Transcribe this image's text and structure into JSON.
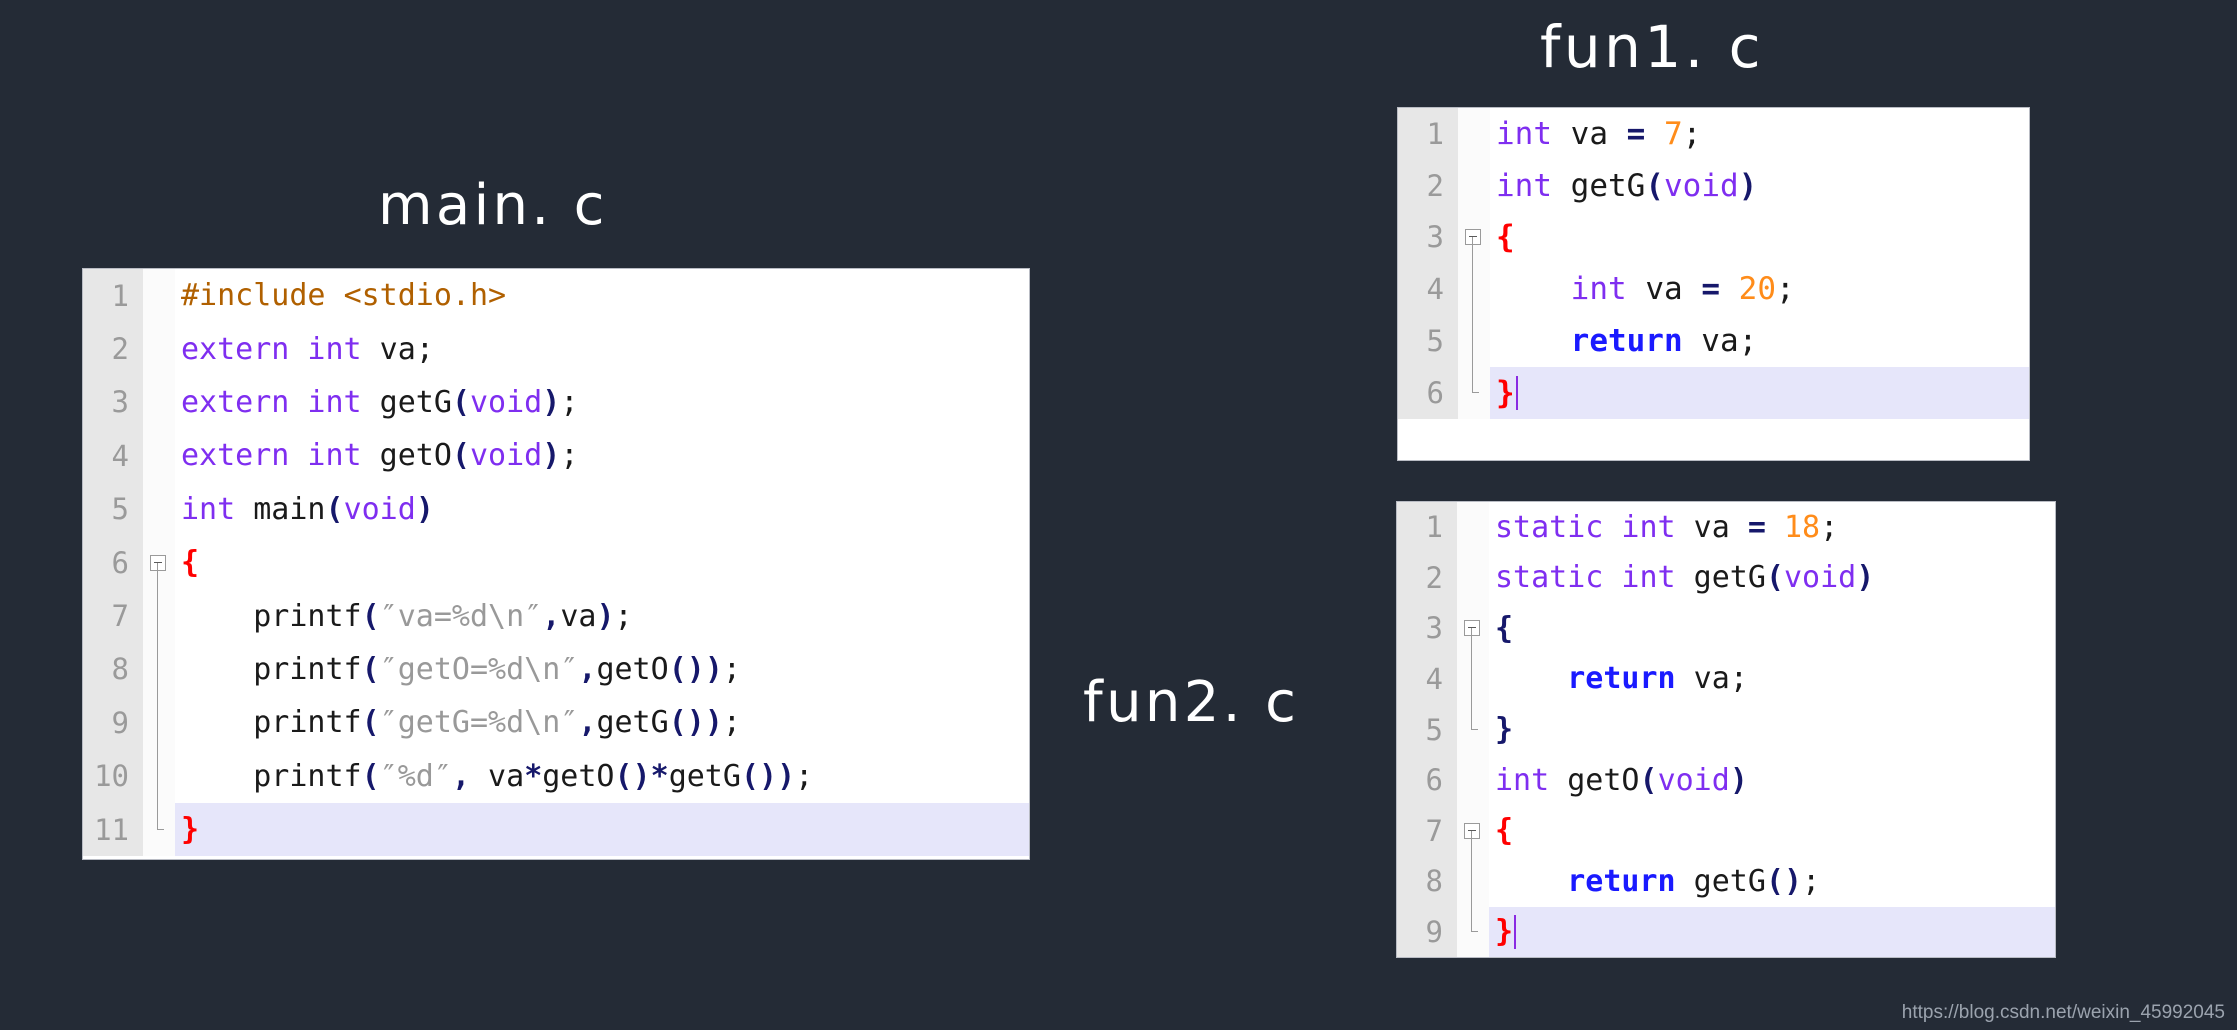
{
  "canvas": {
    "background": "#242b36",
    "watermark": "https://blog.csdn.net/weixin_45992045"
  },
  "labels": {
    "main": "main. c",
    "fun1": "fun1. c",
    "fun2": "fun2. c"
  },
  "colors": {
    "keyword": "#7f2ef0",
    "preprocessor": "#b06000",
    "number": "#ff8c1a",
    "string": "#999999",
    "return": "#1a1aff",
    "punctuation": "#16186b",
    "brace": "#ff0000",
    "plain": "#1a1a1a",
    "line_number": "#9a9a9a",
    "gutter_bg": "#e7e7e7",
    "current_line": "#e6e6fa",
    "editor_bg": "#ffffff",
    "caret": "#8a2be2"
  },
  "editors": {
    "main": {
      "filename": "main. c",
      "lines": [
        {
          "n": "1",
          "fold": "none",
          "current": false,
          "tokens": [
            {
              "t": "#include ",
              "c": "pp"
            },
            {
              "t": "<stdio.h>",
              "c": "inc"
            }
          ]
        },
        {
          "n": "2",
          "fold": "none",
          "current": false,
          "tokens": [
            {
              "t": "extern int",
              "c": "kw"
            },
            {
              "t": " va",
              "c": "plain"
            },
            {
              "t": ";",
              "c": "plain"
            }
          ]
        },
        {
          "n": "3",
          "fold": "none",
          "current": false,
          "tokens": [
            {
              "t": "extern int",
              "c": "kw"
            },
            {
              "t": " getG",
              "c": "plain"
            },
            {
              "t": "(",
              "c": "punc"
            },
            {
              "t": "void",
              "c": "kw"
            },
            {
              "t": ")",
              "c": "punc"
            },
            {
              "t": ";",
              "c": "plain"
            }
          ]
        },
        {
          "n": "4",
          "fold": "none",
          "current": false,
          "tokens": [
            {
              "t": "extern int",
              "c": "kw"
            },
            {
              "t": " getO",
              "c": "plain"
            },
            {
              "t": "(",
              "c": "punc"
            },
            {
              "t": "void",
              "c": "kw"
            },
            {
              "t": ")",
              "c": "punc"
            },
            {
              "t": ";",
              "c": "plain"
            }
          ]
        },
        {
          "n": "5",
          "fold": "none",
          "current": false,
          "tokens": [
            {
              "t": "int",
              "c": "kw"
            },
            {
              "t": " main",
              "c": "plain"
            },
            {
              "t": "(",
              "c": "punc"
            },
            {
              "t": "void",
              "c": "kw"
            },
            {
              "t": ")",
              "c": "punc"
            }
          ]
        },
        {
          "n": "6",
          "fold": "start",
          "current": false,
          "tokens": [
            {
              "t": "{",
              "c": "brace"
            }
          ]
        },
        {
          "n": "7",
          "fold": "mid",
          "current": false,
          "tokens": [
            {
              "t": "    printf",
              "c": "plain"
            },
            {
              "t": "(",
              "c": "punc"
            },
            {
              "t": "″va=%d\\n″",
              "c": "str"
            },
            {
              "t": ",",
              "c": "punc"
            },
            {
              "t": "va",
              "c": "plain"
            },
            {
              "t": ")",
              "c": "punc"
            },
            {
              "t": ";",
              "c": "plain"
            }
          ]
        },
        {
          "n": "8",
          "fold": "mid",
          "current": false,
          "tokens": [
            {
              "t": "    printf",
              "c": "plain"
            },
            {
              "t": "(",
              "c": "punc"
            },
            {
              "t": "″getO=%d\\n″",
              "c": "str"
            },
            {
              "t": ",",
              "c": "punc"
            },
            {
              "t": "getO",
              "c": "plain"
            },
            {
              "t": "()",
              "c": "punc"
            },
            {
              "t": ")",
              "c": "punc"
            },
            {
              "t": ";",
              "c": "plain"
            }
          ]
        },
        {
          "n": "9",
          "fold": "mid",
          "current": false,
          "tokens": [
            {
              "t": "    printf",
              "c": "plain"
            },
            {
              "t": "(",
              "c": "punc"
            },
            {
              "t": "″getG=%d\\n″",
              "c": "str"
            },
            {
              "t": ",",
              "c": "punc"
            },
            {
              "t": "getG",
              "c": "plain"
            },
            {
              "t": "()",
              "c": "punc"
            },
            {
              "t": ")",
              "c": "punc"
            },
            {
              "t": ";",
              "c": "plain"
            }
          ]
        },
        {
          "n": "10",
          "fold": "mid",
          "current": false,
          "tokens": [
            {
              "t": "    printf",
              "c": "plain"
            },
            {
              "t": "(",
              "c": "punc"
            },
            {
              "t": "″%d″",
              "c": "str"
            },
            {
              "t": ",",
              "c": "punc"
            },
            {
              "t": " va",
              "c": "plain"
            },
            {
              "t": "*",
              "c": "op"
            },
            {
              "t": "getO",
              "c": "plain"
            },
            {
              "t": "()",
              "c": "punc"
            },
            {
              "t": "*",
              "c": "op"
            },
            {
              "t": "getG",
              "c": "plain"
            },
            {
              "t": "()",
              "c": "punc"
            },
            {
              "t": ")",
              "c": "punc"
            },
            {
              "t": ";",
              "c": "plain"
            }
          ]
        },
        {
          "n": "11",
          "fold": "end",
          "current": true,
          "tokens": [
            {
              "t": "}",
              "c": "brace"
            }
          ]
        }
      ]
    },
    "fun1": {
      "filename": "fun1. c",
      "lines": [
        {
          "n": "1",
          "fold": "none",
          "current": false,
          "tokens": [
            {
              "t": "int",
              "c": "kw"
            },
            {
              "t": " va ",
              "c": "plain"
            },
            {
              "t": "=",
              "c": "op"
            },
            {
              "t": " ",
              "c": "plain"
            },
            {
              "t": "7",
              "c": "num"
            },
            {
              "t": ";",
              "c": "plain"
            }
          ]
        },
        {
          "n": "2",
          "fold": "none",
          "current": false,
          "tokens": [
            {
              "t": "int",
              "c": "kw"
            },
            {
              "t": " getG",
              "c": "plain"
            },
            {
              "t": "(",
              "c": "punc"
            },
            {
              "t": "void",
              "c": "kw"
            },
            {
              "t": ")",
              "c": "punc"
            }
          ]
        },
        {
          "n": "3",
          "fold": "start",
          "current": false,
          "tokens": [
            {
              "t": "{",
              "c": "brace"
            }
          ]
        },
        {
          "n": "4",
          "fold": "mid",
          "current": false,
          "tokens": [
            {
              "t": "    ",
              "c": "plain"
            },
            {
              "t": "int",
              "c": "kw"
            },
            {
              "t": " va ",
              "c": "plain"
            },
            {
              "t": "=",
              "c": "op"
            },
            {
              "t": " ",
              "c": "plain"
            },
            {
              "t": "20",
              "c": "num"
            },
            {
              "t": ";",
              "c": "plain"
            }
          ]
        },
        {
          "n": "5",
          "fold": "mid",
          "current": false,
          "tokens": [
            {
              "t": "    ",
              "c": "plain"
            },
            {
              "t": "return",
              "c": "ret"
            },
            {
              "t": " va",
              "c": "plain"
            },
            {
              "t": ";",
              "c": "plain"
            }
          ]
        },
        {
          "n": "6",
          "fold": "end",
          "current": true,
          "caret": true,
          "tokens": [
            {
              "t": "}",
              "c": "brace"
            }
          ]
        }
      ]
    },
    "fun2": {
      "filename": "fun2. c",
      "lines": [
        {
          "n": "1",
          "fold": "none",
          "current": false,
          "tokens": [
            {
              "t": "static int",
              "c": "kw"
            },
            {
              "t": " va ",
              "c": "plain"
            },
            {
              "t": "=",
              "c": "op"
            },
            {
              "t": " ",
              "c": "plain"
            },
            {
              "t": "18",
              "c": "num"
            },
            {
              "t": ";",
              "c": "plain"
            }
          ]
        },
        {
          "n": "2",
          "fold": "none",
          "current": false,
          "tokens": [
            {
              "t": "static int",
              "c": "kw"
            },
            {
              "t": " getG",
              "c": "plain"
            },
            {
              "t": "(",
              "c": "punc"
            },
            {
              "t": "void",
              "c": "kw"
            },
            {
              "t": ")",
              "c": "punc"
            }
          ]
        },
        {
          "n": "3",
          "fold": "start",
          "current": false,
          "tokens": [
            {
              "t": "{",
              "c": "punc"
            }
          ]
        },
        {
          "n": "4",
          "fold": "mid",
          "current": false,
          "tokens": [
            {
              "t": "    ",
              "c": "plain"
            },
            {
              "t": "return",
              "c": "ret"
            },
            {
              "t": " va",
              "c": "plain"
            },
            {
              "t": ";",
              "c": "plain"
            }
          ]
        },
        {
          "n": "5",
          "fold": "end",
          "current": false,
          "tokens": [
            {
              "t": "}",
              "c": "punc"
            }
          ]
        },
        {
          "n": "6",
          "fold": "none",
          "current": false,
          "tokens": [
            {
              "t": "int",
              "c": "kw"
            },
            {
              "t": " getO",
              "c": "plain"
            },
            {
              "t": "(",
              "c": "punc"
            },
            {
              "t": "void",
              "c": "kw"
            },
            {
              "t": ")",
              "c": "punc"
            }
          ]
        },
        {
          "n": "7",
          "fold": "start",
          "current": false,
          "tokens": [
            {
              "t": "{",
              "c": "brace"
            }
          ]
        },
        {
          "n": "8",
          "fold": "mid",
          "current": false,
          "tokens": [
            {
              "t": "    ",
              "c": "plain"
            },
            {
              "t": "return",
              "c": "ret"
            },
            {
              "t": " getG",
              "c": "plain"
            },
            {
              "t": "()",
              "c": "punc"
            },
            {
              "t": ";",
              "c": "plain"
            }
          ]
        },
        {
          "n": "9",
          "fold": "end",
          "current": true,
          "caret": true,
          "tokens": [
            {
              "t": "}",
              "c": "brace"
            }
          ]
        }
      ]
    }
  }
}
